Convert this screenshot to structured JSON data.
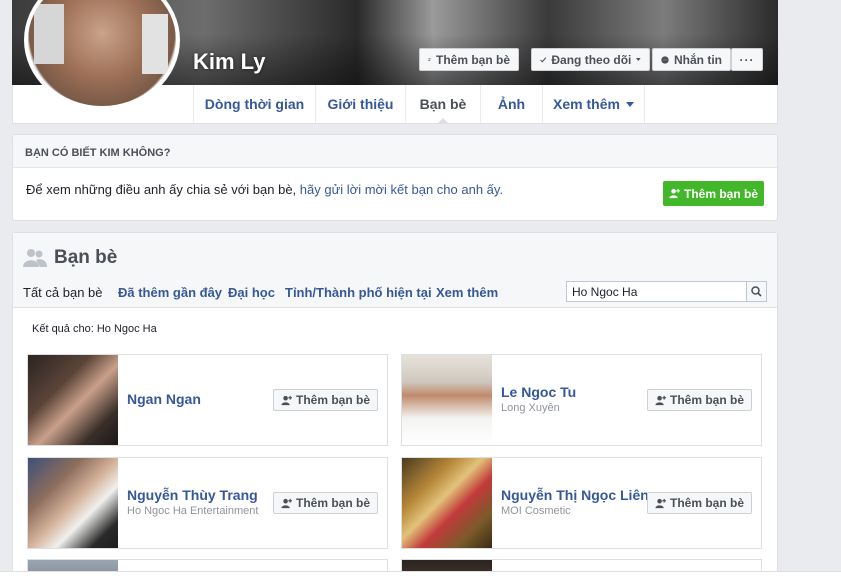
{
  "profile": {
    "name": "Kim Ly",
    "add_friend_label": "Thêm bạn bè",
    "following_label": "Đang theo dõi",
    "message_label": "Nhắn tin",
    "more_label": "···"
  },
  "tabs": [
    {
      "label": "Dòng thời gian"
    },
    {
      "label": "Giới thiệu"
    },
    {
      "label": "Bạn bè"
    },
    {
      "label": "Ảnh"
    },
    {
      "label": "Xem thêm"
    }
  ],
  "suggest": {
    "heading": "BẠN CÓ BIẾT KIM KHÔNG?",
    "text": "Để xem những điều anh ấy chia sẻ với bạn bè, ",
    "link": "hãy gửi lời mời kết bạn cho anh ấy.",
    "button": "Thêm bạn bè"
  },
  "friends": {
    "title": "Bạn bè",
    "tabs": [
      {
        "label": "Tất cả bạn bè"
      },
      {
        "label": "Đã thêm gần đây"
      },
      {
        "label": "Đại học"
      },
      {
        "label": "Tỉnh/Thành phố hiện tại"
      },
      {
        "label": "Xem thêm"
      }
    ],
    "search_value": "Ho Ngoc Ha",
    "result_label": "Kết quả cho: Ho Ngoc Ha",
    "add_label": "Thêm bạn bè",
    "items": [
      {
        "name": "Ngan Ngan",
        "sub": ""
      },
      {
        "name": "Le Ngoc Tu",
        "sub": "Long Xuyên"
      },
      {
        "name": "Nguyễn Thùy Trang",
        "sub": "Ho Ngoc Ha Entertainment"
      },
      {
        "name": "Nguyễn Thị Ngọc Liên",
        "sub": "MOI Cosmetic"
      }
    ]
  },
  "colors": {
    "link": "#365899",
    "green": "#42b72a",
    "bg": "#e9ebee"
  }
}
